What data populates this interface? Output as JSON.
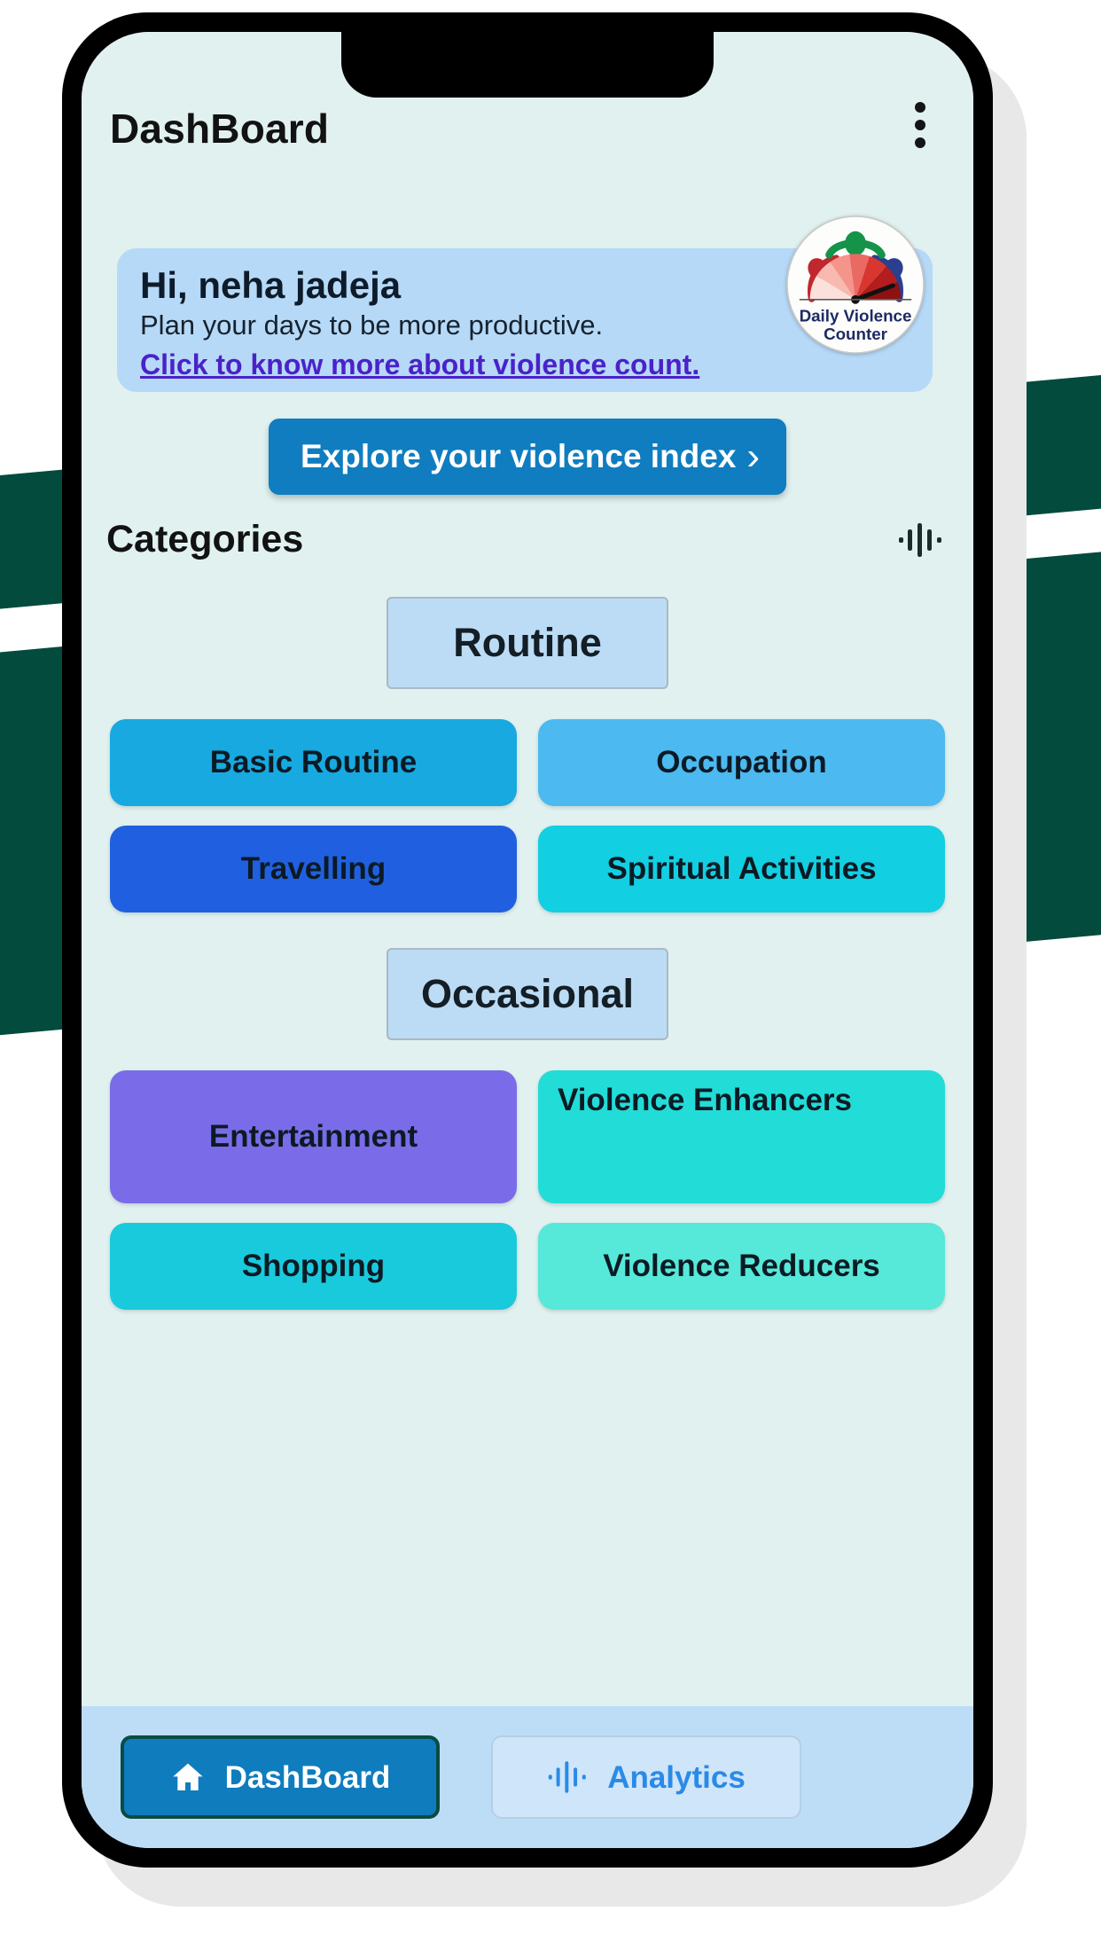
{
  "appbar": {
    "title": "DashBoard",
    "overflow_icon": "more-vertical-icon"
  },
  "brand": {
    "logo_icon": "daily-violence-counter-logo",
    "logo_line1": "Daily Violence",
    "logo_line2": "Counter"
  },
  "greeting": {
    "title": "Hi, neha jadeja",
    "subtitle": "Plan your days to be more productive.",
    "link": "Click to know more about violence count."
  },
  "explore": {
    "label": "Explore your violence index",
    "chevron": "›",
    "chevron_icon": "chevron-right-icon"
  },
  "categories": {
    "title": "Categories",
    "wave_icon": "audio-waveform-icon",
    "sections": [
      {
        "name": "Routine",
        "tiles": [
          {
            "label": "Basic Routine",
            "color": "#17a9e0",
            "align": "center",
            "tall": false
          },
          {
            "label": "Occupation",
            "color": "#4cb9f0",
            "align": "center",
            "tall": false
          },
          {
            "label": "Travelling",
            "color": "#2060e0",
            "align": "center",
            "tall": false
          },
          {
            "label": "Spiritual Activities",
            "color": "#12cfe2",
            "align": "center",
            "tall": false
          }
        ]
      },
      {
        "name": "Occasional",
        "tiles": [
          {
            "label": "Entertainment",
            "color": "#7a6ce8",
            "align": "center",
            "tall": false
          },
          {
            "label": "Violence Enhancers",
            "color": "#22dcd7",
            "align": "left",
            "tall": true
          },
          {
            "label": "Shopping",
            "color": "#19cadc",
            "align": "center",
            "tall": false
          },
          {
            "label": "Violence Reducers",
            "color": "#56e8d8",
            "align": "center",
            "tall": false
          }
        ]
      }
    ]
  },
  "bottom_nav": {
    "items": [
      {
        "label": "DashBoard",
        "icon": "home-icon",
        "active": true
      },
      {
        "label": "Analytics",
        "icon": "audio-waveform-icon",
        "active": false
      }
    ]
  },
  "colors": {
    "screen_bg": "#e0f1f0",
    "card_bg": "#b6d9f7",
    "accent_blue": "#0f7dc0",
    "link_purple": "#4b21c9",
    "nav_bg": "#bdddf7",
    "nav_active_border": "#0a4b44",
    "backdrop_green": "#034b3c"
  }
}
